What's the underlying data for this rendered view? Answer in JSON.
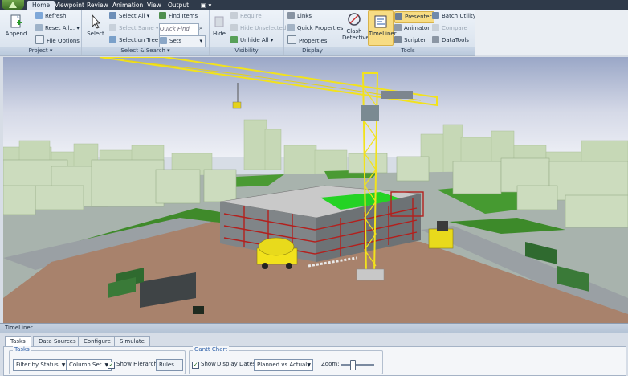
{
  "tabs": [
    "Home",
    "Viewpoint",
    "Review",
    "Animation",
    "View",
    "Output"
  ],
  "ribbon": {
    "project": {
      "append": "Append",
      "refresh": "Refresh",
      "reset_all": "Reset All...",
      "file_options": "File Options",
      "label": "Project"
    },
    "select_search": {
      "select": "Select",
      "select_all": "Select All",
      "select_same": "Select Same",
      "selection_tree": "Selection Tree",
      "find_items": "Find Items",
      "quick_find": "Quick Find",
      "sets": "Sets",
      "label": "Select & Search"
    },
    "visibility": {
      "hide": "Hide",
      "require": "Require",
      "hide_unselected": "Hide Unselected",
      "unhide_all": "Unhide All",
      "label": "Visibility"
    },
    "display": {
      "links": "Links",
      "quick_properties": "Quick Properties",
      "properties": "Properties",
      "label": "Display"
    },
    "tools": {
      "clash_detective": "Clash Detective",
      "timeliner": "TimeLiner",
      "presenter": "Presenter",
      "animator": "Animator",
      "scripter": "Scripter",
      "batch_utility": "Batch Utility",
      "compare": "Compare",
      "datatools": "DataTools",
      "label": "Tools"
    }
  },
  "timeliner": {
    "title": "TimeLiner",
    "tabs": [
      "Tasks",
      "Data Sources",
      "Configure",
      "Simulate"
    ],
    "tasks_group": "Tasks",
    "filter": "Filter by Status",
    "column_set": "Column Set",
    "show_hierarchy": "Show Hierarchy",
    "rules": "Rules...",
    "gantt_group": "Gantt Chart",
    "show": "Show",
    "display_dates_label": "Display Dates:",
    "display_dates": "Planned vs Actual",
    "zoom_label": "Zoom:",
    "zoom_level": 0.35
  },
  "colors": {
    "accent": "#2b5ea8",
    "crane": "#f2e21c",
    "structure_red": "#b3201d",
    "green_roof": "#24d324"
  }
}
